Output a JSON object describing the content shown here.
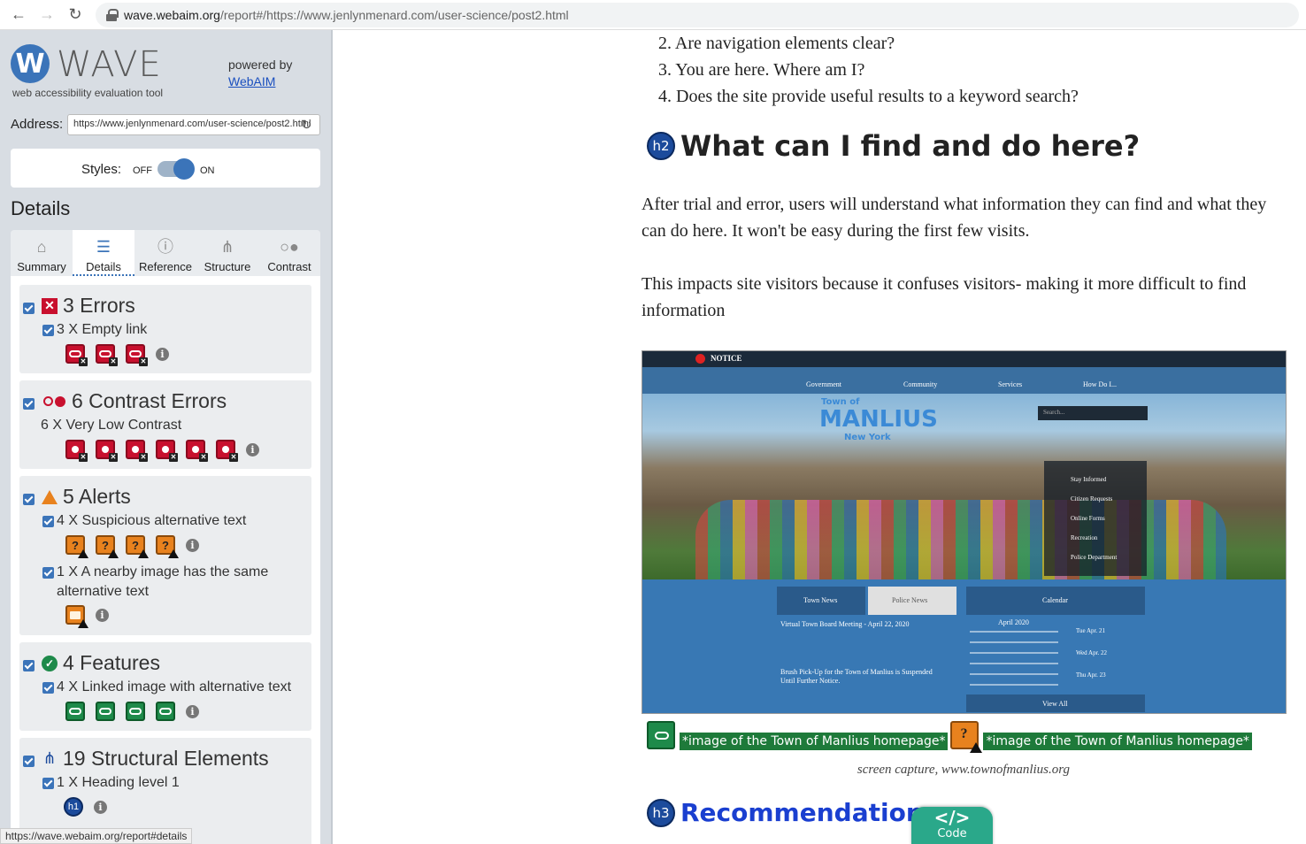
{
  "browser": {
    "url_host": "wave.webaim.org",
    "url_rest": "/report#/https://www.jenlynmenard.com/user-science/post2.html"
  },
  "wave": {
    "logo_letter": "W",
    "title": "WAVE",
    "subtitle": "web accessibility evaluation tool",
    "powered_by": "powered by",
    "powered_link": "WebAIM",
    "address_label": "Address:",
    "address_value": "https://www.jenlynmenard.com/user-science/post2.html",
    "styles_label": "Styles:",
    "styles_off": "OFF",
    "styles_on": "ON",
    "details_heading": "Details",
    "tabs": [
      {
        "label": "Summary",
        "icon": "home-icon"
      },
      {
        "label": "Details",
        "icon": "list-icon"
      },
      {
        "label": "Reference",
        "icon": "info-icon"
      },
      {
        "label": "Structure",
        "icon": "structure-icon"
      },
      {
        "label": "Contrast",
        "icon": "contrast-icon"
      }
    ],
    "active_tab": "Details",
    "sections": {
      "errors": {
        "title": "3 Errors",
        "items": [
          "3 X Empty link"
        ],
        "icon_count": 3
      },
      "contrast": {
        "title": "6 Contrast Errors",
        "items": [
          "6 X Very Low Contrast"
        ],
        "icon_count": 6
      },
      "alerts": {
        "title": "5 Alerts",
        "items": [
          "4 X Suspicious alternative text",
          "1 X A nearby image has the same alternative text"
        ],
        "icon_counts": [
          4,
          1
        ]
      },
      "features": {
        "title": "4 Features",
        "items": [
          "4 X Linked image with alternative text"
        ],
        "icon_count": 4
      },
      "structure": {
        "title": "19 Structural Elements",
        "items": [
          "1 X Heading level 1"
        ],
        "heading_icon_text": "h1"
      }
    },
    "status_url": "https://wave.webaim.org/report#details"
  },
  "page": {
    "list_items": [
      "2. Are navigation elements clear?",
      "3. You are here. Where am I?",
      "4. Does the site provide useful results to a keyword search?"
    ],
    "h2_badge": "h2",
    "h2_text": "What can I find and do here?",
    "para1": "After trial and error, users will understand what information they can find and what they can do here. It won't be easy during the first few visits.",
    "para2": "This impacts site visitors because it confuses visitors- making it more difficult to find information",
    "figure": {
      "notice": "NOTICE",
      "nav": [
        "Government",
        "Community",
        "Services",
        "How Do I..."
      ],
      "search_placeholder": "Search...",
      "logo_top": "Town of",
      "logo_main": "MANLIUS",
      "logo_sub": "New York",
      "quick_links": [
        "Stay Informed",
        "Citizen Requests",
        "Online Forms",
        "Recreation",
        "Police Department"
      ],
      "bottom_tabs": [
        "Town News",
        "Police News",
        "Calendar"
      ],
      "news_title": "Virtual Town Board Meeting - April 22, 2020",
      "news_title2": "Brush Pick-Up for the Town of Manlius is Suspended Until Further Notice.",
      "calendar_month": "April 2020",
      "events": [
        "Tue Apr. 21",
        "Wed Apr. 22",
        "Thu Apr. 23"
      ],
      "view_all": "View All"
    },
    "alt_text_1": "*image of the Town of Manlius homepage*",
    "alt_text_2": "*image of the Town of Manlius homepage*",
    "caption": "screen capture, www.townofmanlius.org",
    "h3_badge": "h3",
    "h3_text": "Recommendation",
    "code_button_symbol": "</>",
    "code_button_label": "Code"
  }
}
